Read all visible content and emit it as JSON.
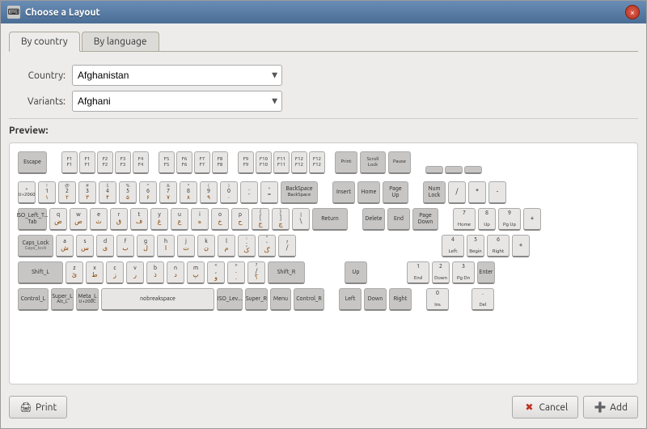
{
  "window": {
    "title": "Choose a Layout",
    "close_label": "×"
  },
  "tabs": [
    {
      "id": "by-country",
      "label": "By country",
      "active": true
    },
    {
      "id": "by-language",
      "label": "By language",
      "active": false
    }
  ],
  "form": {
    "country_label": "Country:",
    "country_value": "Afghanistan",
    "variants_label": "Variants:",
    "variants_value": "Afghani"
  },
  "preview": {
    "label": "Preview:"
  },
  "buttons": {
    "print": "Print",
    "cancel": "Cancel",
    "add": "Add"
  },
  "keyboard": {
    "accent": "#4a7c2f",
    "cancel_color": "#c03020"
  }
}
